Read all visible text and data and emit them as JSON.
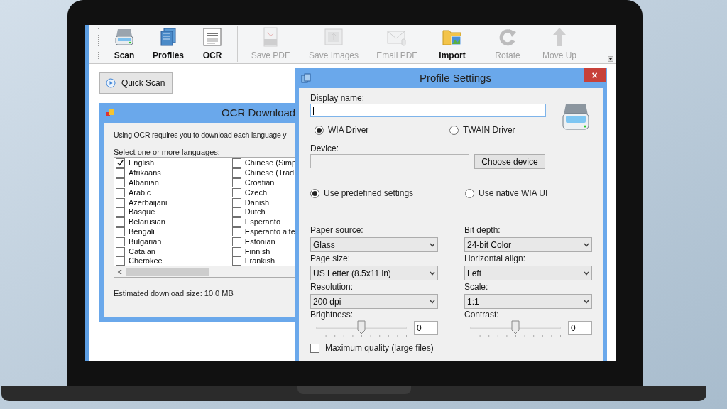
{
  "toolbar": {
    "groups": [
      [
        {
          "label": "Scan",
          "disabled": false
        },
        {
          "label": "Profiles",
          "disabled": false
        },
        {
          "label": "OCR",
          "disabled": false
        }
      ],
      [
        {
          "label": "Save PDF",
          "disabled": true
        },
        {
          "label": "Save Images",
          "disabled": true
        },
        {
          "label": "Email PDF",
          "disabled": true
        },
        {
          "label": "Import",
          "disabled": false
        }
      ],
      [
        {
          "label": "Rotate",
          "disabled": true
        },
        {
          "label": "Move Up",
          "disabled": true
        }
      ]
    ]
  },
  "quick_scan": {
    "label": "Quick Scan"
  },
  "ocr_dialog": {
    "title": "OCR Download",
    "intro": "Using OCR requires you to download each language y",
    "prompt": "Select one or more languages:",
    "columns": [
      [
        {
          "label": "English",
          "checked": true
        },
        {
          "label": "Afrikaans",
          "checked": false
        },
        {
          "label": "Albanian",
          "checked": false
        },
        {
          "label": "Arabic",
          "checked": false
        },
        {
          "label": "Azerbaijani",
          "checked": false
        },
        {
          "label": "Basque",
          "checked": false
        },
        {
          "label": "Belarusian",
          "checked": false
        },
        {
          "label": "Bengali",
          "checked": false
        },
        {
          "label": "Bulgarian",
          "checked": false
        },
        {
          "label": "Catalan",
          "checked": false
        },
        {
          "label": "Cherokee",
          "checked": false
        }
      ],
      [
        {
          "label": "Chinese (Simp",
          "checked": false
        },
        {
          "label": "Chinese (Trad",
          "checked": false
        },
        {
          "label": "Croatian",
          "checked": false
        },
        {
          "label": "Czech",
          "checked": false
        },
        {
          "label": "Danish",
          "checked": false
        },
        {
          "label": "Dutch",
          "checked": false
        },
        {
          "label": "Esperanto",
          "checked": false
        },
        {
          "label": "Esperanto alte",
          "checked": false
        },
        {
          "label": "Estonian",
          "checked": false
        },
        {
          "label": "Finnish",
          "checked": false
        },
        {
          "label": "Frankish",
          "checked": false
        }
      ]
    ],
    "estimate": "Estimated download size: 10.0 MB"
  },
  "profile_dialog": {
    "title": "Profile Settings",
    "close": "×",
    "display_name_label": "Display name:",
    "drivers": [
      {
        "label": "WIA Driver",
        "selected": true
      },
      {
        "label": "TWAIN Driver",
        "selected": false
      }
    ],
    "device_label": "Device:",
    "choose_device": "Choose device",
    "modes": [
      {
        "label": "Use predefined settings",
        "selected": true
      },
      {
        "label": "Use native WIA UI",
        "selected": false
      }
    ],
    "selects": [
      {
        "label": "Paper source:",
        "value": "Glass"
      },
      {
        "label": "Bit depth:",
        "value": "24-bit Color"
      },
      {
        "label": "Page size:",
        "value": "US Letter (8.5x11 in)"
      },
      {
        "label": "Horizontal align:",
        "value": "Left"
      },
      {
        "label": "Resolution:",
        "value": "200 dpi"
      },
      {
        "label": "Scale:",
        "value": "1:1"
      }
    ],
    "sliders": [
      {
        "label": "Brightness:",
        "level": 0.5,
        "value": "0"
      },
      {
        "label": "Contrast:",
        "level": 0.5,
        "value": "0"
      }
    ],
    "max_quality": {
      "label": "Maximum quality (large files)",
      "checked": false
    }
  }
}
